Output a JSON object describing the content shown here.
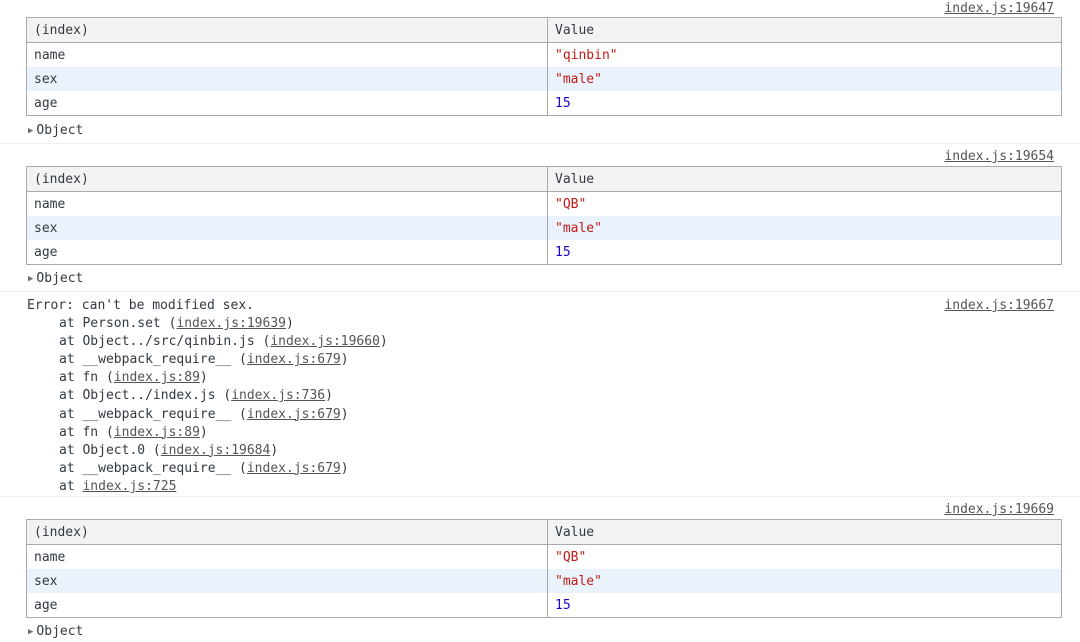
{
  "logs": [
    {
      "source": "index.js:19647",
      "headers": [
        "(index)",
        "Value"
      ],
      "rows": [
        {
          "key": "name",
          "value": "\"qinbin\"",
          "kind": "string"
        },
        {
          "key": "sex",
          "value": "\"male\"",
          "kind": "string"
        },
        {
          "key": "age",
          "value": "15",
          "kind": "number"
        }
      ],
      "summary": "Object"
    },
    {
      "source": "index.js:19654",
      "headers": [
        "(index)",
        "Value"
      ],
      "rows": [
        {
          "key": "name",
          "value": "\"QB\"",
          "kind": "string"
        },
        {
          "key": "sex",
          "value": "\"male\"",
          "kind": "string"
        },
        {
          "key": "age",
          "value": "15",
          "kind": "number"
        }
      ],
      "summary": "Object"
    },
    {
      "source": "index.js:19669",
      "headers": [
        "(index)",
        "Value"
      ],
      "rows": [
        {
          "key": "name",
          "value": "\"QB\"",
          "kind": "string"
        },
        {
          "key": "sex",
          "value": "\"male\"",
          "kind": "string"
        },
        {
          "key": "age",
          "value": "15",
          "kind": "number"
        }
      ],
      "summary": "Object"
    }
  ],
  "error": {
    "source": "index.js:19667",
    "message": "Error: can't be modified sex.",
    "stack": [
      {
        "prefix": "at Person.set (",
        "link": "index.js:19639",
        "suffix": ")"
      },
      {
        "prefix": "at Object../src/qinbin.js (",
        "link": "index.js:19660",
        "suffix": ")"
      },
      {
        "prefix": "at __webpack_require__ (",
        "link": "index.js:679",
        "suffix": ")"
      },
      {
        "prefix": "at fn (",
        "link": "index.js:89",
        "suffix": ")"
      },
      {
        "prefix": "at Object../index.js (",
        "link": "index.js:736",
        "suffix": ")"
      },
      {
        "prefix": "at __webpack_require__ (",
        "link": "index.js:679",
        "suffix": ")"
      },
      {
        "prefix": "at fn (",
        "link": "index.js:89",
        "suffix": ")"
      },
      {
        "prefix": "at Object.0 (",
        "link": "index.js:19684",
        "suffix": ")"
      },
      {
        "prefix": "at __webpack_require__ (",
        "link": "index.js:679",
        "suffix": ")"
      },
      {
        "prefix": "at ",
        "link": "index.js:725",
        "suffix": ""
      }
    ]
  },
  "colors": {
    "string": "#c41a16",
    "number": "#1c00cf",
    "link": "#545454",
    "row_alt": "#eaf3fb",
    "header_bg": "#f3f3f3"
  },
  "icons": {
    "expand": "triangle-right-icon"
  }
}
